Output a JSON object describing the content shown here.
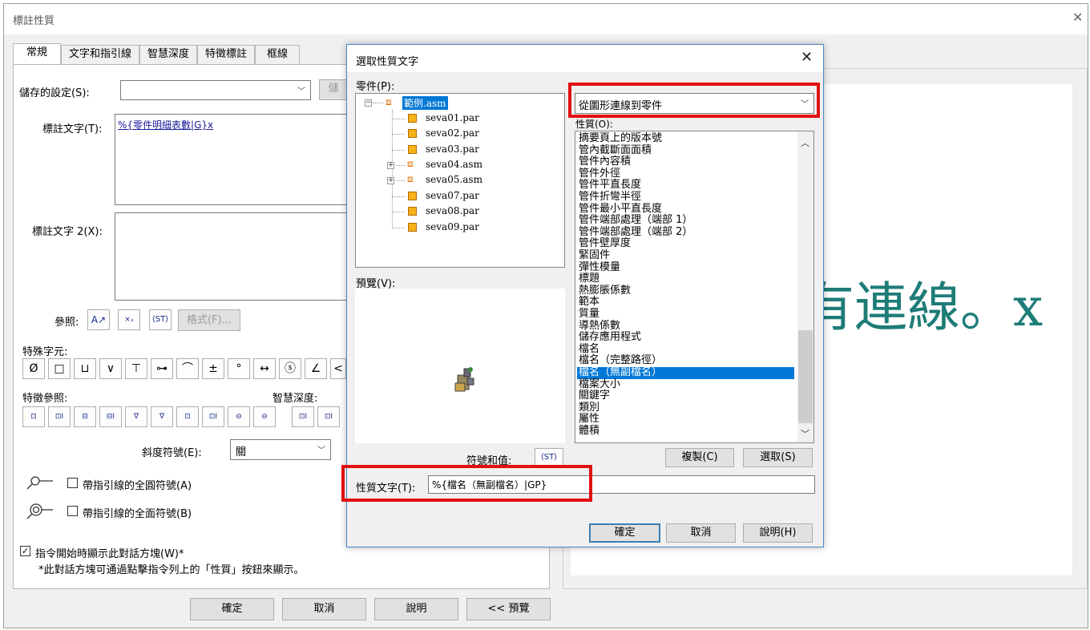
{
  "main_window": {
    "title": "標註性質",
    "tabs": [
      "常規",
      "文字和指引線",
      "智慧深度",
      "特徵標註",
      "框線"
    ],
    "saved_settings_label": "儲存的設定(S):",
    "saved_settings_value": "",
    "callout_text_label": "標註文字(T):",
    "callout_text_value": "%{零件明細表數|G}x",
    "callout_text2_label": "標註文字 2(X):",
    "callout_text2_value": "",
    "reference_label": "參照:",
    "format_button": "格式(F)...",
    "special_chars_label": "特殊字元:",
    "special_chars": [
      "Ø",
      "□",
      "⊔",
      "∨",
      "⊤",
      "⊶",
      "⌒",
      "±",
      "°",
      "↔",
      "ⓢ",
      "∠",
      "<"
    ],
    "feature_ref_label": "特徵參照:",
    "smart_depth_label": "智慧深度:",
    "feature_ref_icons": [
      "⊡",
      "⊡I",
      "⊟",
      "⊟I",
      "∇",
      "∇",
      "⊡",
      "⊡I",
      "⊖",
      "⊖"
    ],
    "smart_depth_icons": [
      "⊡I",
      "⊡I"
    ],
    "slope_label": "斜度符號(E):",
    "slope_value": "關",
    "checkbox_a": "帶指引線的全圓符號(A)",
    "checkbox_b": "帶指引線的全面符號(B)",
    "show_dialog_checkbox": "指令開始時顯示此對話方塊(W)*",
    "footnote": "*此對話方塊可通過點擊指令列上的「性質」按鈕來顯示。",
    "ok": "確定",
    "cancel": "取消",
    "help": "說明",
    "preview": "<< 預覽",
    "preview_text": "有連線。x",
    "hidden_button": "儲"
  },
  "dialog": {
    "title": "選取性質文字",
    "parts_label": "零件(P):",
    "tree": [
      {
        "name": "範例.asm",
        "type": "asm",
        "selected": true,
        "level": 0,
        "expander": "minus"
      },
      {
        "name": "seva01.par",
        "type": "par",
        "level": 1
      },
      {
        "name": "seva02.par",
        "type": "par",
        "level": 1
      },
      {
        "name": "seva03.par",
        "type": "par",
        "level": 1
      },
      {
        "name": "seva04.asm",
        "type": "asm",
        "level": 1,
        "expander": "plus"
      },
      {
        "name": "seva05.asm",
        "type": "asm",
        "level": 1,
        "expander": "plus"
      },
      {
        "name": "seva07.par",
        "type": "par",
        "level": 1
      },
      {
        "name": "seva08.par",
        "type": "par",
        "level": 1
      },
      {
        "name": "seva09.par",
        "type": "par",
        "level": 1
      }
    ],
    "preview_label": "預覽(V):",
    "source_combo": "從圖形連線到零件",
    "properties_label": "性質(O):",
    "properties": [
      "摘要頁上的版本號",
      "管內截斷面面積",
      "管件內容積",
      "管件外徑",
      "管件平直長度",
      "管件折彎半徑",
      "管件最小平直長度",
      "管件端部處理（端部 1）",
      "管件端部處理（端部 2）",
      "管件壁厚度",
      "緊固件",
      "彈性模量",
      "標題",
      "熱膨脹係數",
      "範本",
      "質量",
      "導熱係數",
      "儲存應用程式",
      "檔名",
      "檔名（完整路徑）",
      "檔名（無副檔名）",
      "檔案大小",
      "關鍵字",
      "類別",
      "屬性",
      "體積"
    ],
    "selected_property": "檔名（無副檔名）",
    "symbol_value_label": "符號和值:",
    "copy_button": "複製(C)",
    "select_button": "選取(S)",
    "property_text_label": "性質文字(T):",
    "property_text_value": "%{檔名（無副檔名）|GP}",
    "ok": "確定",
    "cancel": "取消",
    "help": "說明(H)"
  },
  "colors": {
    "highlight": "#e01010",
    "selection": "#0078d7",
    "preview_text": "#1e7c78"
  }
}
